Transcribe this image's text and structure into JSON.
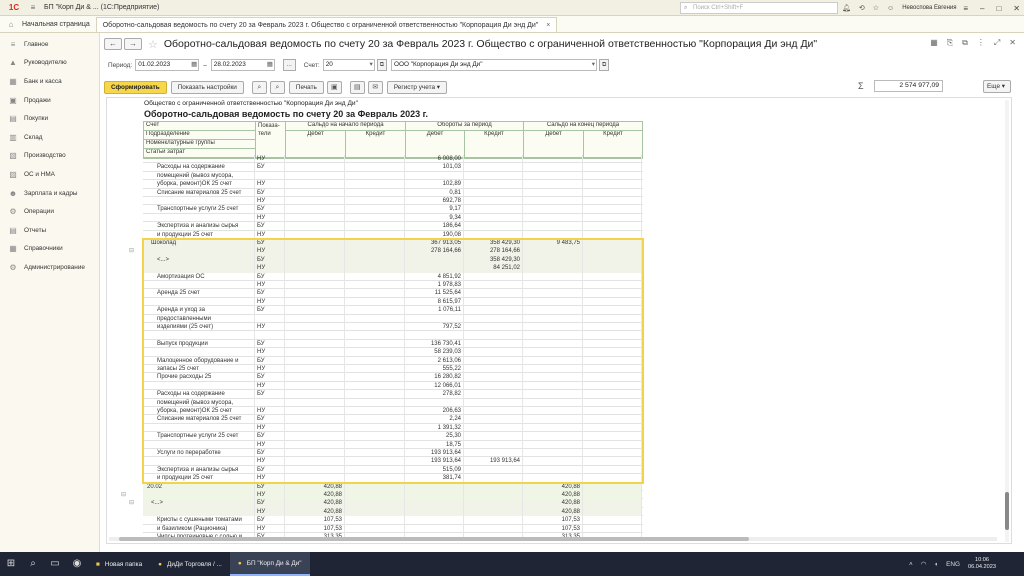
{
  "app": {
    "logo": "1С",
    "title": "БП \"Корп Ди & ...  (1С:Предприятие)",
    "search_placeholder": "Поиск Ctrl+Shift+F",
    "user": "Невоспова Евгения"
  },
  "tabs": [
    {
      "label": "Начальная страница"
    },
    {
      "label": "Оборотно-сальдовая ведомость по счету 20 за Февраль 2023 г. Общество с ограниченной ответственностью \"Корпорация Ди энд Ди\""
    }
  ],
  "sidebar": {
    "items": [
      {
        "label": "Главное",
        "icon": "menu-icon"
      },
      {
        "label": "Руководителю",
        "icon": "chart-icon"
      },
      {
        "label": "Банк и касса",
        "icon": "bank-icon"
      },
      {
        "label": "Продажи",
        "icon": "cart-icon"
      },
      {
        "label": "Покупки",
        "icon": "basket-icon"
      },
      {
        "label": "Склад",
        "icon": "box-icon"
      },
      {
        "label": "Производство",
        "icon": "factory-icon"
      },
      {
        "label": "ОС и НМА",
        "icon": "building-icon"
      },
      {
        "label": "Зарплата и кадры",
        "icon": "people-icon"
      },
      {
        "label": "Операции",
        "icon": "gear-icon"
      },
      {
        "label": "Отчеты",
        "icon": "report-icon"
      },
      {
        "label": "Справочники",
        "icon": "book-icon"
      },
      {
        "label": "Администрирование",
        "icon": "settings-icon"
      }
    ]
  },
  "document": {
    "title": "Оборотно-сальдовая ведомость по счету 20 за Февраль 2023 г. Общество с ограниченной ответственностью \"Корпорация Ди энд Ди\"",
    "period_label": "Период:",
    "period_from": "01.02.2023",
    "period_to": "28.02.2023",
    "dots_label": "...",
    "account_label": "Счет:",
    "account_value": "20",
    "org_value": "ООО \"Корпорация Ди энд Ди\""
  },
  "toolbar": {
    "generate": "Сформировать",
    "show_settings": "Показать настройки",
    "print": "Печать",
    "register": "Регистр учета",
    "sum_total": "2 574 977,09",
    "more": "Еще"
  },
  "report": {
    "org_line": "Общество с ограниченной ответственностью \"Корпорация Ди энд Ди\"",
    "title": "Оборотно-сальдовая ведомость по счету 20 за Февраль 2023 г.",
    "headers": {
      "account": "Счет",
      "subdivision": "Подразделение",
      "nomenclature": "Номенклатурные группы",
      "cost_items": "Статьи затрат",
      "indicators": "Показа-тели",
      "opening": "Сальдо на начало периода",
      "turnover": "Обороты за период",
      "closing": "Сальдо на конец периода",
      "debit": "Дебет",
      "credit": "Кредит"
    },
    "rows": [
      {
        "name": "",
        "ind": "НУ",
        "od": "",
        "oc": "",
        "td": "6 008,00",
        "tc": "",
        "cd": "",
        "cc": ""
      },
      {
        "name": "Расходы на содержание",
        "ind": "БУ",
        "od": "",
        "oc": "",
        "td": "101,03",
        "tc": "",
        "cd": "",
        "cc": ""
      },
      {
        "name": "помещений (вывоз мусора,",
        "ind": "",
        "od": "",
        "oc": "",
        "td": "",
        "tc": "",
        "cd": "",
        "cc": ""
      },
      {
        "name": "уборка, ремонт)ОК 25 счет",
        "ind": "НУ",
        "od": "",
        "oc": "",
        "td": "102,89",
        "tc": "",
        "cd": "",
        "cc": ""
      },
      {
        "name": "Списание материалов 25 счет",
        "ind": "БУ",
        "od": "",
        "oc": "",
        "td": "0,81",
        "tc": "",
        "cd": "",
        "cc": ""
      },
      {
        "name": "",
        "ind": "НУ",
        "od": "",
        "oc": "",
        "td": "692,78",
        "tc": "",
        "cd": "",
        "cc": ""
      },
      {
        "name": "Транспортные услуги 25 счет",
        "ind": "БУ",
        "od": "",
        "oc": "",
        "td": "9,17",
        "tc": "",
        "cd": "",
        "cc": ""
      },
      {
        "name": "",
        "ind": "НУ",
        "od": "",
        "oc": "",
        "td": "9,34",
        "tc": "",
        "cd": "",
        "cc": ""
      },
      {
        "name": "Экспертиза и анализы сырья",
        "ind": "БУ",
        "od": "",
        "oc": "",
        "td": "186,64",
        "tc": "",
        "cd": "",
        "cc": ""
      },
      {
        "name": "и продукции 25 счет",
        "ind": "НУ",
        "od": "",
        "oc": "",
        "td": "190,08",
        "tc": "",
        "cd": "",
        "cc": ""
      },
      {
        "name": "Шоколад",
        "ind": "БУ",
        "od": "",
        "oc": "",
        "td": "367 913,05",
        "tc": "358 429,30",
        "cd": "9 483,75",
        "cc": "",
        "lvl": 1
      },
      {
        "name": "",
        "ind": "НУ",
        "od": "",
        "oc": "",
        "td": "278 164,66",
        "tc": "278 164,66",
        "cd": "",
        "cc": "",
        "lvl": 1
      },
      {
        "name": "<...>",
        "ind": "БУ",
        "od": "",
        "oc": "",
        "td": "",
        "tc": "358 429,30",
        "cd": "",
        "cc": "",
        "lvl": 2
      },
      {
        "name": "",
        "ind": "НУ",
        "od": "",
        "oc": "",
        "td": "",
        "tc": "84 251,02",
        "cd": "",
        "cc": "",
        "lvl": 2
      },
      {
        "name": "Амортизация ОС",
        "ind": "БУ",
        "od": "",
        "oc": "",
        "td": "4 851,92",
        "tc": "",
        "cd": "",
        "cc": ""
      },
      {
        "name": "",
        "ind": "НУ",
        "od": "",
        "oc": "",
        "td": "1 978,83",
        "tc": "",
        "cd": "",
        "cc": ""
      },
      {
        "name": "Аренда 25 счет",
        "ind": "БУ",
        "od": "",
        "oc": "",
        "td": "11 525,64",
        "tc": "",
        "cd": "",
        "cc": ""
      },
      {
        "name": "",
        "ind": "НУ",
        "od": "",
        "oc": "",
        "td": "8 615,97",
        "tc": "",
        "cd": "",
        "cc": ""
      },
      {
        "name": "Аренда и уход за",
        "ind": "БУ",
        "od": "",
        "oc": "",
        "td": "1 076,11",
        "tc": "",
        "cd": "",
        "cc": ""
      },
      {
        "name": "предоставленными",
        "ind": "",
        "od": "",
        "oc": "",
        "td": "",
        "tc": "",
        "cd": "",
        "cc": ""
      },
      {
        "name": "изделиями (25 счет)",
        "ind": "НУ",
        "od": "",
        "oc": "",
        "td": "797,52",
        "tc": "",
        "cd": "",
        "cc": ""
      },
      {
        "name": "",
        "ind": "",
        "od": "",
        "oc": "",
        "td": "",
        "tc": "",
        "cd": "",
        "cc": ""
      },
      {
        "name": "Выпуск продукции",
        "ind": "БУ",
        "od": "",
        "oc": "",
        "td": "136 730,41",
        "tc": "",
        "cd": "",
        "cc": ""
      },
      {
        "name": "",
        "ind": "НУ",
        "od": "",
        "oc": "",
        "td": "58 239,03",
        "tc": "",
        "cd": "",
        "cc": ""
      },
      {
        "name": "Малоценное оборудование и",
        "ind": "БУ",
        "od": "",
        "oc": "",
        "td": "2 613,06",
        "tc": "",
        "cd": "",
        "cc": ""
      },
      {
        "name": "запасы 25 счет",
        "ind": "НУ",
        "od": "",
        "oc": "",
        "td": "555,22",
        "tc": "",
        "cd": "",
        "cc": ""
      },
      {
        "name": "Прочие расходы 25",
        "ind": "БУ",
        "od": "",
        "oc": "",
        "td": "16 280,82",
        "tc": "",
        "cd": "",
        "cc": ""
      },
      {
        "name": "",
        "ind": "НУ",
        "od": "",
        "oc": "",
        "td": "12 066,01",
        "tc": "",
        "cd": "",
        "cc": ""
      },
      {
        "name": "Расходы на содержание",
        "ind": "БУ",
        "od": "",
        "oc": "",
        "td": "278,82",
        "tc": "",
        "cd": "",
        "cc": ""
      },
      {
        "name": "помещений (вывоз мусора,",
        "ind": "",
        "od": "",
        "oc": "",
        "td": "",
        "tc": "",
        "cd": "",
        "cc": ""
      },
      {
        "name": "уборка, ремонт)ОК 25 счет",
        "ind": "НУ",
        "od": "",
        "oc": "",
        "td": "206,63",
        "tc": "",
        "cd": "",
        "cc": ""
      },
      {
        "name": "Списание материалов 25 счет",
        "ind": "БУ",
        "od": "",
        "oc": "",
        "td": "2,24",
        "tc": "",
        "cd": "",
        "cc": ""
      },
      {
        "name": "",
        "ind": "НУ",
        "od": "",
        "oc": "",
        "td": "1 391,32",
        "tc": "",
        "cd": "",
        "cc": ""
      },
      {
        "name": "Транспортные услуги 25 счет",
        "ind": "БУ",
        "od": "",
        "oc": "",
        "td": "25,30",
        "tc": "",
        "cd": "",
        "cc": ""
      },
      {
        "name": "",
        "ind": "НУ",
        "od": "",
        "oc": "",
        "td": "18,75",
        "tc": "",
        "cd": "",
        "cc": ""
      },
      {
        "name": "Услуги по переработке",
        "ind": "БУ",
        "od": "",
        "oc": "",
        "td": "193 913,64",
        "tc": "",
        "cd": "",
        "cc": ""
      },
      {
        "name": "",
        "ind": "НУ",
        "od": "",
        "oc": "",
        "td": "193 913,64",
        "tc": "193 913,64",
        "cd": "",
        "cc": ""
      },
      {
        "name": "Экспертиза и анализы сырья",
        "ind": "БУ",
        "od": "",
        "oc": "",
        "td": "515,09",
        "tc": "",
        "cd": "",
        "cc": ""
      },
      {
        "name": "и продукции 25 счет",
        "ind": "НУ",
        "od": "",
        "oc": "",
        "td": "381,74",
        "tc": "",
        "cd": "",
        "cc": ""
      },
      {
        "name": "20.02",
        "ind": "БУ",
        "od": "420,88",
        "oc": "",
        "td": "",
        "tc": "",
        "cd": "420,88",
        "cc": "",
        "lvl": 0
      },
      {
        "name": "",
        "ind": "НУ",
        "od": "420,88",
        "oc": "",
        "td": "",
        "tc": "",
        "cd": "420,88",
        "cc": "",
        "lvl": 0
      },
      {
        "name": "<...>",
        "ind": "БУ",
        "od": "420,88",
        "oc": "",
        "td": "",
        "tc": "",
        "cd": "420,88",
        "cc": "",
        "lvl": 1
      },
      {
        "name": "",
        "ind": "НУ",
        "od": "420,88",
        "oc": "",
        "td": "",
        "tc": "",
        "cd": "420,88",
        "cc": "",
        "lvl": 1
      },
      {
        "name": "Криспы с сушеными томатами",
        "ind": "БУ",
        "od": "107,53",
        "oc": "",
        "td": "",
        "tc": "",
        "cd": "107,53",
        "cc": ""
      },
      {
        "name": "и базиликом (Рационика)",
        "ind": "НУ",
        "od": "107,53",
        "oc": "",
        "td": "",
        "tc": "",
        "cd": "107,53",
        "cc": ""
      },
      {
        "name": "Чипсы протеиновые с солью и",
        "ind": "БУ",
        "od": "313,35",
        "oc": "",
        "td": "",
        "tc": "",
        "cd": "313,35",
        "cc": ""
      }
    ]
  },
  "taskbar": {
    "apps": [
      {
        "label": "Новая папка"
      },
      {
        "label": "ДиДи Торговля / ..."
      },
      {
        "label": "БП \"Корп Ди & Ди\""
      }
    ],
    "lang": "ENG",
    "time": "10:06",
    "date": "06.04.2023"
  }
}
